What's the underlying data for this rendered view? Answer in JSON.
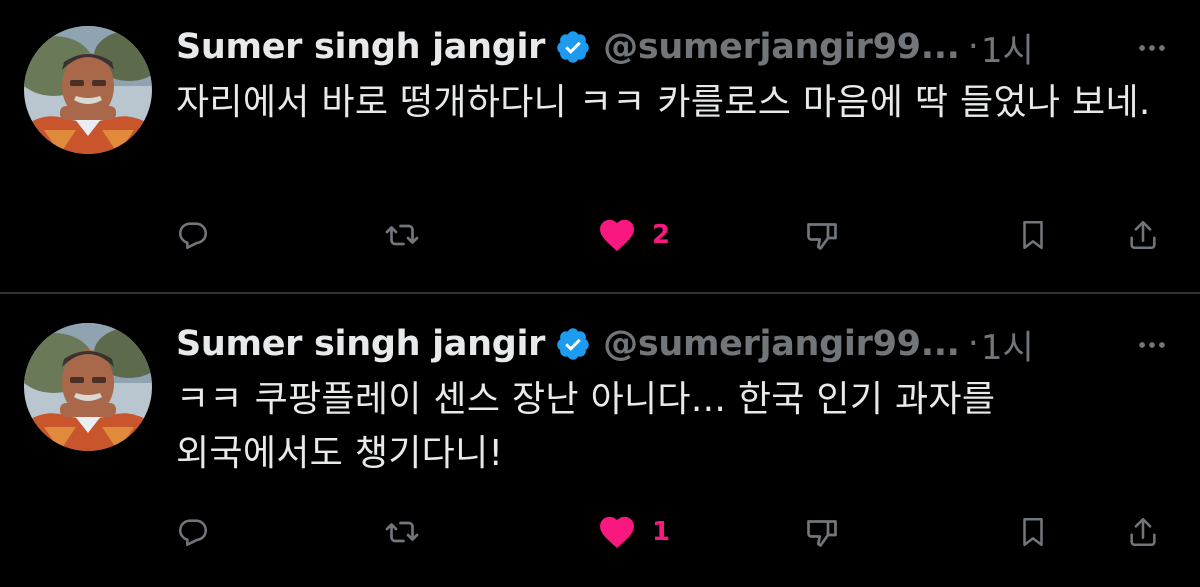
{
  "colors": {
    "background": "#000000",
    "text_primary": "#e7e9ea",
    "text_secondary": "#71767b",
    "verified_blue": "#1d9bf0",
    "like_pink": "#f91880",
    "divider": "#2f3336"
  },
  "tweets": [
    {
      "author_name": "Sumer singh jangir",
      "handle": "@sumerjangir99...",
      "separator": "·",
      "time": "1시",
      "text": "자리에서 바로 떵개하다니 ㅋㅋ 카를로스 마음에 딱 들었나 보네.",
      "like_count": "2",
      "liked": true,
      "icons": {
        "avatar": "profile-photo",
        "verified": "verified-badge-icon",
        "more": "more-icon",
        "reply": "reply-icon",
        "repost": "repost-icon",
        "like": "heart-icon",
        "dislike": "dislike-icon",
        "bookmark": "bookmark-icon",
        "share": "share-icon"
      }
    },
    {
      "author_name": "Sumer singh jangir",
      "handle": "@sumerjangir99...",
      "separator": "·",
      "time": "1시",
      "text": "ㅋㅋ 쿠팡플레이 센스 장난 아니다... 한국 인기 과자를 외국에서도 챙기다니!",
      "like_count": "1",
      "liked": true,
      "icons": {
        "avatar": "profile-photo",
        "verified": "verified-badge-icon",
        "more": "more-icon",
        "reply": "reply-icon",
        "repost": "repost-icon",
        "like": "heart-icon",
        "dislike": "dislike-icon",
        "bookmark": "bookmark-icon",
        "share": "share-icon"
      }
    }
  ]
}
